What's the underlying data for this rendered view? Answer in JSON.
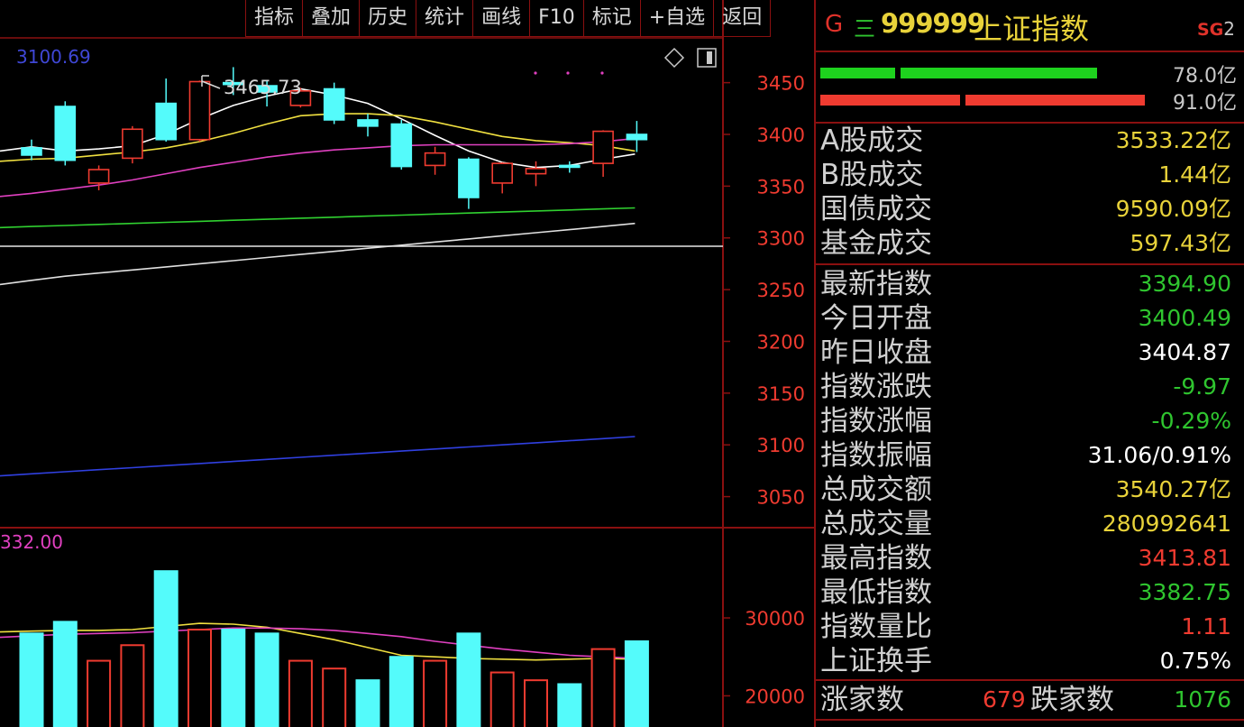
{
  "toolbar": {
    "items": [
      "指标",
      "叠加",
      "历史",
      "统计",
      "画线",
      "F10",
      "标记",
      "+自选",
      "返回"
    ]
  },
  "chart_header": {
    "ma_readout": "3100.69",
    "peak_label": "3465.73",
    "vol_readout": "332.00"
  },
  "colors": {
    "bull_candle": "#ef3b30",
    "bear_candle": "#54fbfb",
    "ma5": "#ffffff",
    "ma10": "#f0e040",
    "ma20": "#e040c0",
    "ma60": "#30d030",
    "ma120": "#e0e0e0",
    "ma250": "#3040e0",
    "axis_label": "#ef3b30",
    "grid_line": "#8a1010"
  },
  "chart_data": [
    {
      "type": "candlestick",
      "title": "",
      "ylim": [
        3020,
        3495
      ],
      "y_ticks": [
        3450,
        3400,
        3350,
        3300,
        3250,
        3200,
        3150,
        3100,
        3050
      ],
      "candles": [
        {
          "o": 3387,
          "c": 3380,
          "h": 3395,
          "l": 3375
        },
        {
          "o": 3427,
          "c": 3375,
          "h": 3432,
          "l": 3370
        },
        {
          "o": 3353,
          "c": 3366,
          "h": 3370,
          "l": 3346
        },
        {
          "o": 3377,
          "c": 3405,
          "h": 3408,
          "l": 3372
        },
        {
          "o": 3430,
          "c": 3395,
          "h": 3454,
          "l": 3393
        },
        {
          "o": 3395,
          "c": 3451,
          "h": 3452,
          "l": 3393
        },
        {
          "o": 3450,
          "c": 3449,
          "h": 3465,
          "l": 3438
        },
        {
          "o": 3447,
          "c": 3441,
          "h": 3452,
          "l": 3427
        },
        {
          "o": 3428,
          "c": 3442,
          "h": 3445,
          "l": 3426
        },
        {
          "o": 3444,
          "c": 3414,
          "h": 3450,
          "l": 3410
        },
        {
          "o": 3414,
          "c": 3408,
          "h": 3420,
          "l": 3398
        },
        {
          "o": 3410,
          "c": 3369,
          "h": 3414,
          "l": 3366
        },
        {
          "o": 3370,
          "c": 3382,
          "h": 3388,
          "l": 3361
        },
        {
          "o": 3376,
          "c": 3339,
          "h": 3378,
          "l": 3328
        },
        {
          "o": 3353,
          "c": 3372,
          "h": 3373,
          "l": 3343
        },
        {
          "o": 3362,
          "c": 3367,
          "h": 3374,
          "l": 3350
        },
        {
          "o": 3370,
          "c": 3369,
          "h": 3374,
          "l": 3363
        },
        {
          "o": 3372,
          "c": 3403,
          "h": 3404,
          "l": 3359
        },
        {
          "o": 3400,
          "c": 3395,
          "h": 3413,
          "l": 3383
        }
      ],
      "series": [
        {
          "values": [
            3384,
            3388,
            3384,
            3386,
            3389,
            3400,
            3415,
            3428,
            3437,
            3444,
            3438,
            3430,
            3415,
            3399,
            3384,
            3373,
            3368,
            3370,
            3376,
            3381
          ]
        },
        {
          "values": [
            3374,
            3376,
            3377,
            3380,
            3383,
            3387,
            3393,
            3401,
            3410,
            3418,
            3420,
            3420,
            3418,
            3412,
            3405,
            3398,
            3394,
            3392,
            3389,
            3384
          ]
        },
        {
          "values": [
            3340,
            3343,
            3347,
            3351,
            3356,
            3362,
            3368,
            3373,
            3378,
            3382,
            3385,
            3387,
            3389,
            3390,
            3390,
            3390,
            3390,
            3391,
            3393,
            3396
          ]
        },
        {
          "values": [
            3310,
            3311,
            3312,
            3313,
            3314,
            3315,
            3316,
            3317,
            3318,
            3319,
            3320,
            3321,
            3322,
            3323,
            3324,
            3325,
            3326,
            3327,
            3328,
            3329
          ]
        },
        {
          "values": [
            3255,
            3259,
            3263,
            3266,
            3269,
            3272,
            3275,
            3278,
            3281,
            3284,
            3287,
            3290,
            3293,
            3296,
            3299,
            3302,
            3305,
            3308,
            3311,
            3314
          ]
        },
        {
          "values": [
            3070,
            3072,
            3074,
            3076,
            3078,
            3080,
            3082,
            3084,
            3086,
            3088,
            3090,
            3092,
            3094,
            3096,
            3098,
            3100,
            3102,
            3104,
            3106,
            3108
          ]
        }
      ]
    },
    {
      "type": "bar",
      "title": "",
      "ylim": [
        16000,
        41000
      ],
      "y_ticks": [
        30000,
        20000
      ],
      "values": [
        28000,
        29500,
        24500,
        26500,
        36000,
        28500,
        28500,
        28000,
        24500,
        23500,
        22000,
        25000,
        24500,
        28000,
        23000,
        22000,
        21500,
        26000,
        27000
      ],
      "up": [
        false,
        false,
        true,
        true,
        false,
        true,
        false,
        false,
        true,
        true,
        false,
        false,
        true,
        false,
        true,
        true,
        false,
        true,
        false
      ],
      "series": [
        {
          "values": [
            28200,
            28300,
            28400,
            28400,
            28500,
            28900,
            29300,
            29200,
            28800,
            28000,
            27200,
            26200,
            25200,
            25000,
            24800,
            24700,
            24600,
            24700,
            24800,
            24700
          ]
        },
        {
          "values": [
            27500,
            27700,
            27900,
            28000,
            28100,
            28300,
            28500,
            28700,
            28700,
            28600,
            28400,
            28000,
            27600,
            27000,
            26500,
            26000,
            25600,
            25200,
            25000,
            24800
          ]
        }
      ]
    }
  ],
  "panel": {
    "header": {
      "g_label": "G",
      "eq_label": "三",
      "code": "999999",
      "name": "上证指数",
      "sg": "SG",
      "sg_num": "2"
    },
    "ratio_bars": [
      {
        "value_label": "78.0亿",
        "color": "#1ed21e",
        "fraction": 0.58
      },
      {
        "value_label": "91.0亿",
        "color": "#ef3b30",
        "fraction": 0.68
      }
    ],
    "turnover": [
      {
        "label": "A股成交",
        "value": "3533.22亿",
        "color": "#e8d23a"
      },
      {
        "label": "B股成交",
        "value": "1.44亿",
        "color": "#e8d23a"
      },
      {
        "label": "国债成交",
        "value": "9590.09亿",
        "color": "#e8d23a"
      },
      {
        "label": "基金成交",
        "value": "597.43亿",
        "color": "#e8d23a"
      }
    ],
    "stats": [
      {
        "label": "最新指数",
        "value": "3394.90",
        "color": "#2fc52f"
      },
      {
        "label": "今日开盘",
        "value": "3400.49",
        "color": "#2fc52f"
      },
      {
        "label": "昨日收盘",
        "value": "3404.87",
        "color": "#ffffff"
      },
      {
        "label": "指数涨跌",
        "value": "-9.97",
        "color": "#2fc52f"
      },
      {
        "label": "指数涨幅",
        "value": "-0.29%",
        "color": "#2fc52f"
      },
      {
        "label": "指数振幅",
        "value": "31.06/0.91%",
        "color": "#ffffff"
      },
      {
        "label": "总成交额",
        "value": "3540.27亿",
        "color": "#e8d23a"
      },
      {
        "label": "总成交量",
        "value": "280992641",
        "color": "#e8d23a"
      },
      {
        "label": "最高指数",
        "value": "3413.81",
        "color": "#ef3b30"
      },
      {
        "label": "最低指数",
        "value": "3382.75",
        "color": "#2fc52f"
      },
      {
        "label": "指数量比",
        "value": "1.11",
        "color": "#ef3b30"
      },
      {
        "label": "上证换手",
        "value": "0.75%",
        "color": "#ffffff"
      }
    ],
    "breadth": {
      "up_label": "涨家数",
      "up_value": "679",
      "down_label": "跌家数",
      "down_value": "1076"
    }
  }
}
